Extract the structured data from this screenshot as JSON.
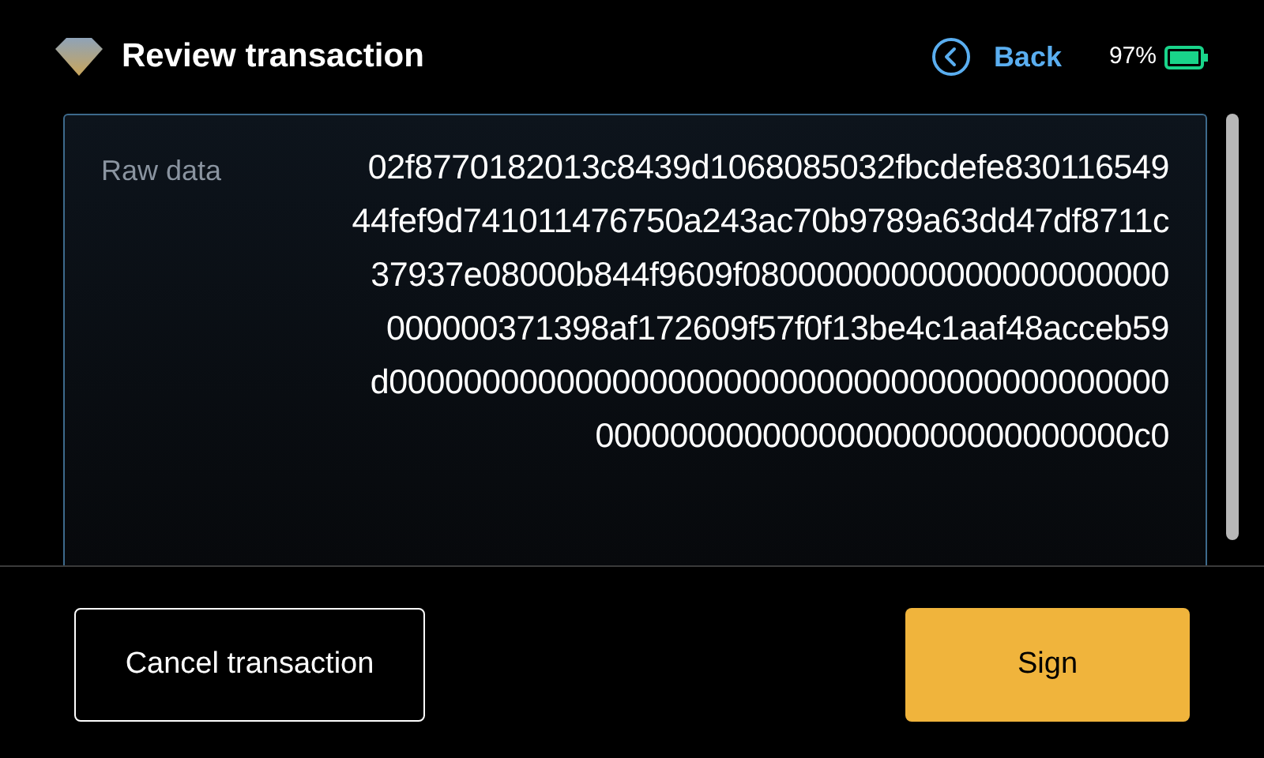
{
  "header": {
    "title": "Review transaction",
    "back": "Back",
    "battery": "97%"
  },
  "field": {
    "label": "Raw data",
    "lines": [
      "02f8770182013c8439d1068085032fbcdefe830116549",
      "44fef9d741011476750a243ac70b9789a63dd47df8711c",
      "37937e08000b844f9609f08000000000000000000000",
      "000000371398af172609f57f0f13be4c1aaf48acceb59",
      "d000000000000000000000000000000000000000000",
      "00000000000000000000000000000c0"
    ]
  },
  "buttons": [
    {
      "label": "Cancel transaction",
      "kind": "secondary"
    },
    {
      "label": "Sign",
      "kind": "primary"
    }
  ]
}
